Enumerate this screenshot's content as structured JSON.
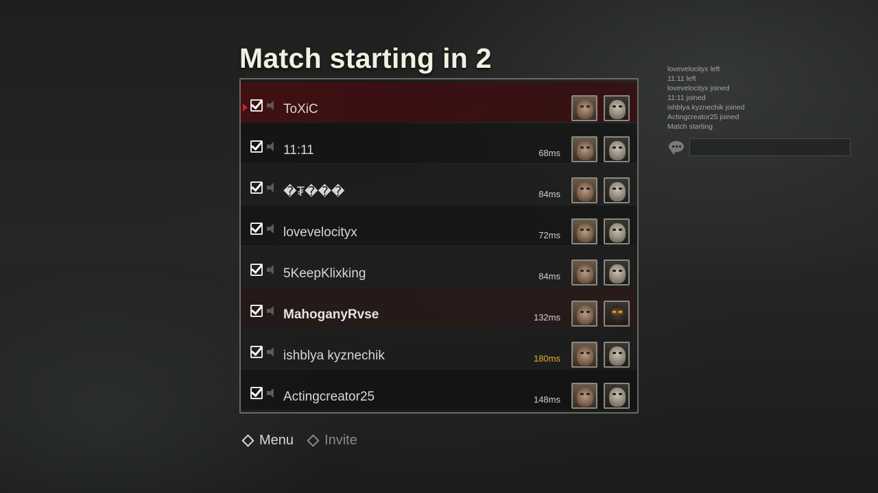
{
  "title": "Match starting in 2",
  "players": [
    {
      "name": "ToXiC",
      "ping": "",
      "host": true,
      "bold": false,
      "killer_mask": "pale"
    },
    {
      "name": "11:11",
      "ping": "68ms",
      "host": false,
      "bold": false,
      "killer_mask": "pale"
    },
    {
      "name": "�₮���",
      "ping": "84ms",
      "host": false,
      "bold": false,
      "killer_mask": "pale"
    },
    {
      "name": "lovevelocityx",
      "ping": "72ms",
      "host": false,
      "bold": false,
      "killer_mask": "pale"
    },
    {
      "name": "5KeepKlixking",
      "ping": "84ms",
      "host": false,
      "bold": false,
      "killer_mask": "pale"
    },
    {
      "name": "MahoganyRvse",
      "ping": "132ms",
      "host": false,
      "bold": true,
      "killer_mask": "dark"
    },
    {
      "name": "ishblya kyznechik",
      "ping": "180ms",
      "host": false,
      "bold": false,
      "ping_warning": true,
      "killer_mask": "pale"
    },
    {
      "name": "Actingcreator25",
      "ping": "148ms",
      "host": false,
      "bold": false,
      "killer_mask": "pale"
    }
  ],
  "footer": {
    "menu_label": "Menu",
    "invite_label": "Invite"
  },
  "chat": {
    "log": [
      "lovevelocityx left",
      "11:11 left",
      "lovevelocityx joined",
      "11:11 joined",
      "ishblya kyznechik joined",
      "Actingcreator25 joined",
      "Match starting"
    ],
    "input_value": "",
    "icon": "chat-bubble-icon"
  },
  "colors": {
    "host_row": "#460e10",
    "ping_warning": "#e8b030",
    "title": "#f2f0e0"
  }
}
